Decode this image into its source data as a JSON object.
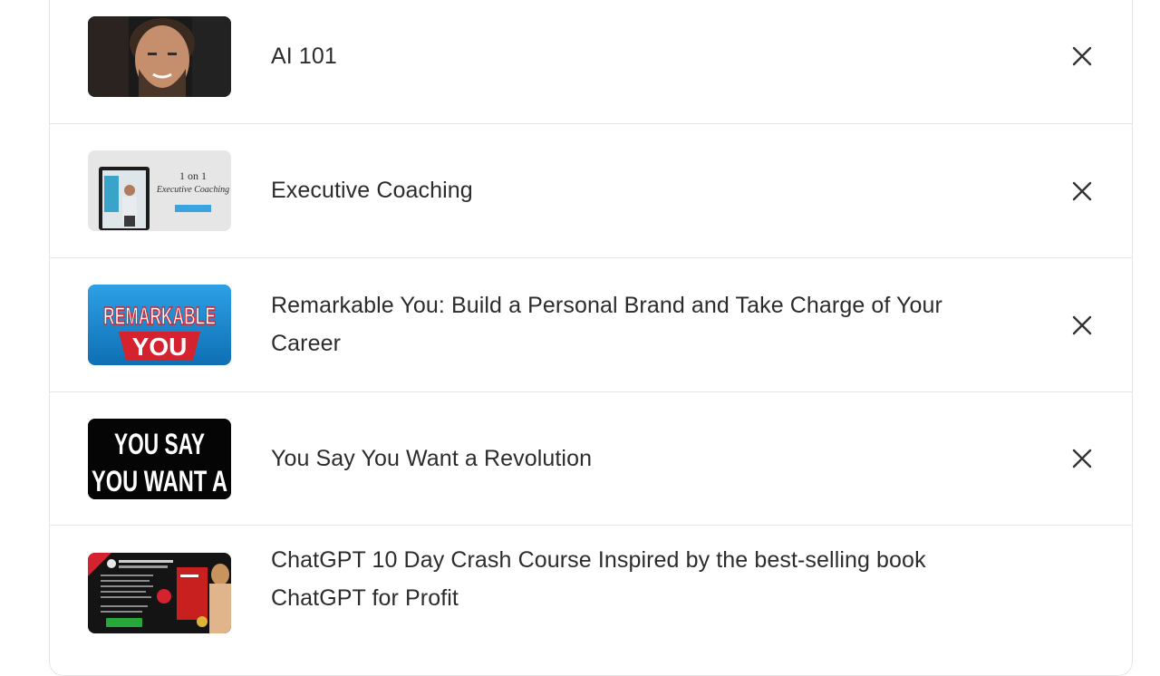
{
  "courses": [
    {
      "title": "AI 101",
      "thumbnail": "instructor-portrait",
      "removable": true
    },
    {
      "title": "Executive Coaching",
      "thumbnail": "executive-coaching-banner",
      "thumb_text": "1 on 1 Executive Coaching",
      "removable": true
    },
    {
      "title": "Remarkable You: Build a Personal Brand and Take Charge of Your Career",
      "thumbnail": "remarkable-you-banner",
      "thumb_text_1": "REMARKABLE",
      "thumb_text_2": "YOU",
      "removable": true
    },
    {
      "title": "You Say You Want a Revolution",
      "thumbnail": "revolution-banner",
      "thumb_text_1": "YOU SAY",
      "thumb_text_2": "YOU WANT A",
      "removable": true
    },
    {
      "title": "ChatGPT 10 Day Crash Course Inspired by the best-selling book ChatGPT for Profit",
      "thumbnail": "chatgpt-crash-course-banner"
    }
  ],
  "colors": {
    "divider": "#e4e4e4",
    "text": "#2c2c2c",
    "close_icon": "#333333"
  }
}
